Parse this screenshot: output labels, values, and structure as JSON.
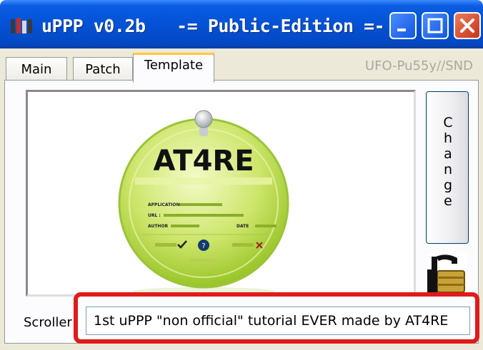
{
  "window": {
    "title": "uPPP v0.2b   -= Public-Edition =-",
    "buttons": [
      "minimize-icon",
      "maximize-icon",
      "close-icon"
    ]
  },
  "tabs": [
    {
      "label": "Main",
      "active": false
    },
    {
      "label": "Patch",
      "active": false
    },
    {
      "label": "Template",
      "active": true
    }
  ],
  "brand": "UFO-Pu55y//SND",
  "preview": {
    "logo_text": "AT4RE",
    "info_labels": [
      "APPLICATION :",
      "URL :",
      "AUTHOR",
      "DATE"
    ]
  },
  "change_button": {
    "letters": [
      "C",
      "h",
      "a",
      "n",
      "g",
      "e"
    ]
  },
  "lock_icon": "padlock-icon",
  "scroller": {
    "label": "Scroller",
    "value": "1st uPPP \"non official\" tutorial EVER made by AT4RE"
  },
  "colors": {
    "titlebar": "#0452d6",
    "highlight": "#e01b1b",
    "tab_accent": "#ffc83c",
    "disc": "#b7d63c"
  }
}
